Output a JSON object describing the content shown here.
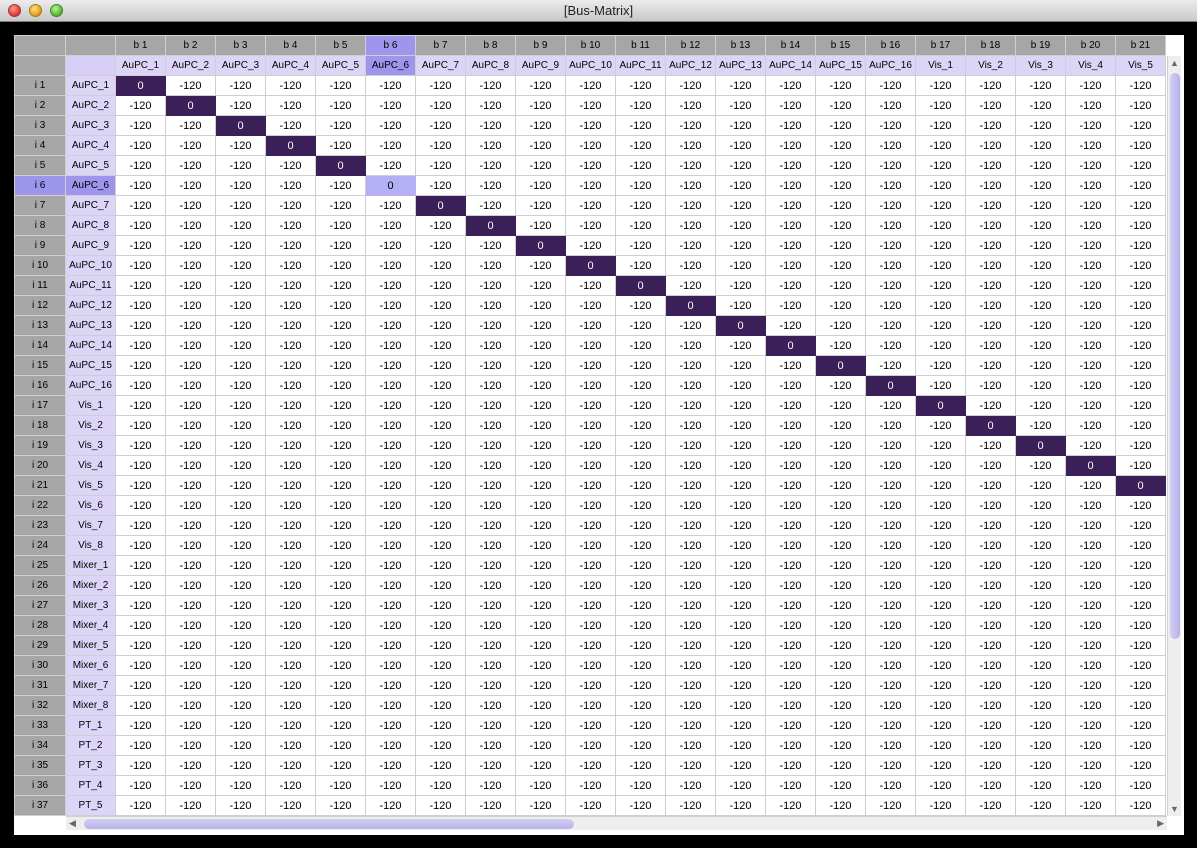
{
  "window": {
    "title": "[Bus-Matrix]"
  },
  "matrix": {
    "selected_bus_index": 6,
    "selected_input_index": 6,
    "default_value": "-120",
    "diagonal_value": "0",
    "buses": [
      {
        "num": "b 1",
        "name": "AuPC_1"
      },
      {
        "num": "b 2",
        "name": "AuPC_2"
      },
      {
        "num": "b 3",
        "name": "AuPC_3"
      },
      {
        "num": "b 4",
        "name": "AuPC_4"
      },
      {
        "num": "b 5",
        "name": "AuPC_5"
      },
      {
        "num": "b 6",
        "name": "AuPC_6"
      },
      {
        "num": "b 7",
        "name": "AuPC_7"
      },
      {
        "num": "b 8",
        "name": "AuPC_8"
      },
      {
        "num": "b 9",
        "name": "AuPC_9"
      },
      {
        "num": "b 10",
        "name": "AuPC_10"
      },
      {
        "num": "b 11",
        "name": "AuPC_11"
      },
      {
        "num": "b 12",
        "name": "AuPC_12"
      },
      {
        "num": "b 13",
        "name": "AuPC_13"
      },
      {
        "num": "b 14",
        "name": "AuPC_14"
      },
      {
        "num": "b 15",
        "name": "AuPC_15"
      },
      {
        "num": "b 16",
        "name": "AuPC_16"
      },
      {
        "num": "b 17",
        "name": "Vis_1"
      },
      {
        "num": "b 18",
        "name": "Vis_2"
      },
      {
        "num": "b 19",
        "name": "Vis_3"
      },
      {
        "num": "b 20",
        "name": "Vis_4"
      },
      {
        "num": "b 21",
        "name": "Vis_5"
      }
    ],
    "inputs": [
      {
        "num": "i 1",
        "name": "AuPC_1"
      },
      {
        "num": "i 2",
        "name": "AuPC_2"
      },
      {
        "num": "i 3",
        "name": "AuPC_3"
      },
      {
        "num": "i 4",
        "name": "AuPC_4"
      },
      {
        "num": "i 5",
        "name": "AuPC_5"
      },
      {
        "num": "i 6",
        "name": "AuPC_6"
      },
      {
        "num": "i 7",
        "name": "AuPC_7"
      },
      {
        "num": "i 8",
        "name": "AuPC_8"
      },
      {
        "num": "i 9",
        "name": "AuPC_9"
      },
      {
        "num": "i 10",
        "name": "AuPC_10"
      },
      {
        "num": "i 11",
        "name": "AuPC_11"
      },
      {
        "num": "i 12",
        "name": "AuPC_12"
      },
      {
        "num": "i 13",
        "name": "AuPC_13"
      },
      {
        "num": "i 14",
        "name": "AuPC_14"
      },
      {
        "num": "i 15",
        "name": "AuPC_15"
      },
      {
        "num": "i 16",
        "name": "AuPC_16"
      },
      {
        "num": "i 17",
        "name": "Vis_1"
      },
      {
        "num": "i 18",
        "name": "Vis_2"
      },
      {
        "num": "i 19",
        "name": "Vis_3"
      },
      {
        "num": "i 20",
        "name": "Vis_4"
      },
      {
        "num": "i 21",
        "name": "Vis_5"
      },
      {
        "num": "i 22",
        "name": "Vis_6"
      },
      {
        "num": "i 23",
        "name": "Vis_7"
      },
      {
        "num": "i 24",
        "name": "Vis_8"
      },
      {
        "num": "i 25",
        "name": "Mixer_1"
      },
      {
        "num": "i 26",
        "name": "Mixer_2"
      },
      {
        "num": "i 27",
        "name": "Mixer_3"
      },
      {
        "num": "i 28",
        "name": "Mixer_4"
      },
      {
        "num": "i 29",
        "name": "Mixer_5"
      },
      {
        "num": "i 30",
        "name": "Mixer_6"
      },
      {
        "num": "i 31",
        "name": "Mixer_7"
      },
      {
        "num": "i 32",
        "name": "Mixer_8"
      },
      {
        "num": "i 33",
        "name": "PT_1"
      },
      {
        "num": "i 34",
        "name": "PT_2"
      },
      {
        "num": "i 35",
        "name": "PT_3"
      },
      {
        "num": "i 36",
        "name": "PT_4"
      },
      {
        "num": "i 37",
        "name": "PT_5"
      }
    ]
  },
  "colors": {
    "diagonal_cell": "#3b1f58",
    "selection": "#9d96ec",
    "header_gray": "#a6a6a6",
    "name_lavender": "#dcd5f7"
  },
  "icons": {
    "close": "close-icon",
    "minimize": "minimize-icon",
    "maximize": "maximize-icon",
    "scroll_up": "arrow-up-icon",
    "scroll_down": "arrow-down-icon",
    "scroll_left": "arrow-left-icon",
    "scroll_right": "arrow-right-icon"
  },
  "scroll": {
    "vertical_position": 0.0,
    "horizontal_position": 0.0
  }
}
